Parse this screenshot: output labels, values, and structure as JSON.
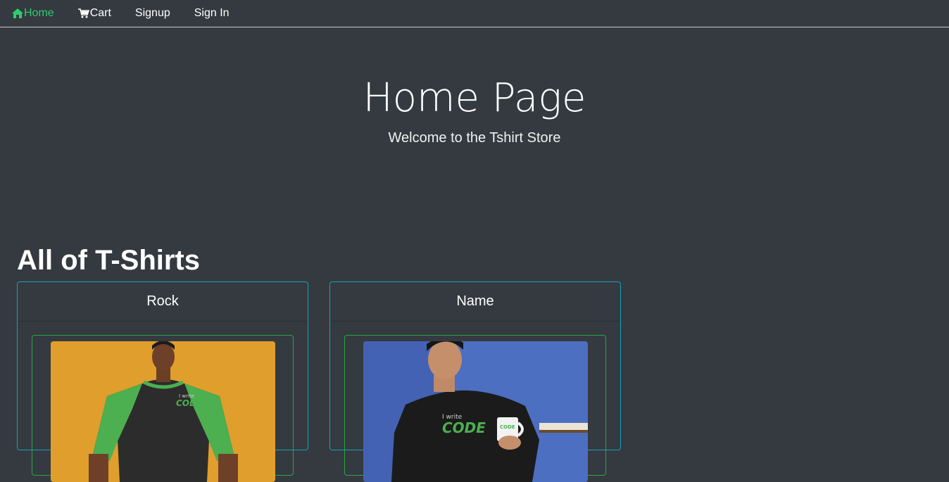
{
  "nav": {
    "home": "Home",
    "cart": "Cart",
    "signup": "Signup",
    "signin": "Sign In"
  },
  "hero": {
    "title": "Home Page",
    "subtitle": "Welcome to the Tshirt Store"
  },
  "section": {
    "title": "All of T-Shirts"
  },
  "products": [
    {
      "name": "Rock",
      "shirt_text_small": "I write",
      "shirt_text_big": "CODE"
    },
    {
      "name": "Name",
      "shirt_text_small": "I write",
      "shirt_text_big": "CODE"
    }
  ],
  "colors": {
    "background": "#343a40",
    "accent": "#2ecc71",
    "card_border": "#17a2b8",
    "frame_border": "#28a745"
  }
}
